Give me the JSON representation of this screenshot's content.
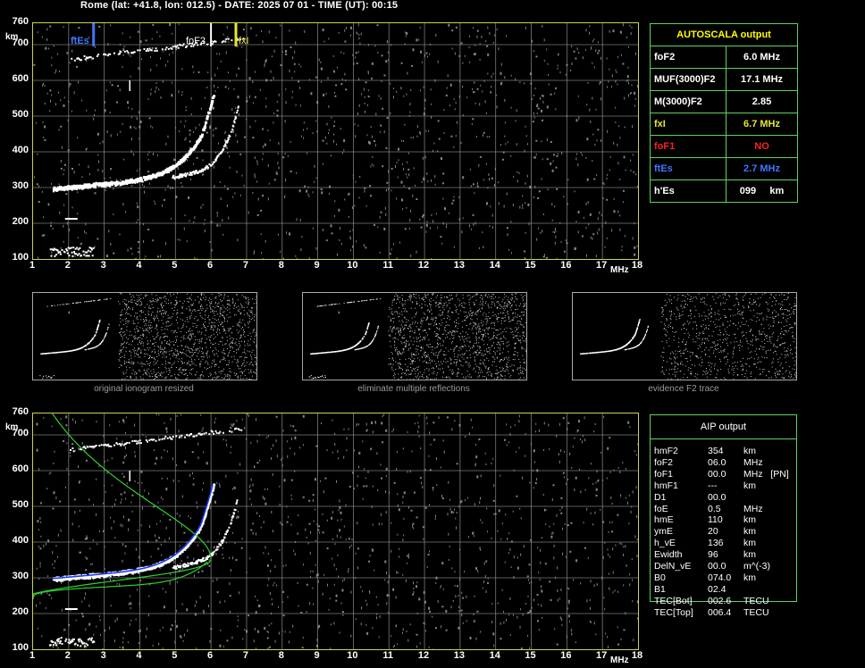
{
  "header": {
    "title": "Rome (lat: +41.8, lon: 012.5) - DATE: 2025 07 01 - TIME (UT): 00:15"
  },
  "axes": {
    "y_ticks": [
      "100",
      "200",
      "300",
      "400",
      "500",
      "600",
      "700",
      "760"
    ],
    "y_unit": "km",
    "x_ticks": [
      "1",
      "2",
      "3",
      "4",
      "5",
      "6",
      "7",
      "8",
      "9",
      "10",
      "11",
      "12",
      "13",
      "14",
      "15",
      "16",
      "17",
      "18"
    ],
    "x_unit": "MHz"
  },
  "markers": {
    "ftEs_label": "ftEs",
    "foF2_label": "foF2",
    "fxI_label": "fxI"
  },
  "thumbnails": {
    "captions": [
      "original ionogram resized",
      "eliminate multiple reflections",
      "evidence F2 trace"
    ]
  },
  "autoscala": {
    "title": "AUTOSCALA output",
    "rows": [
      {
        "param": "foF2",
        "value": "6.0 MHz",
        "color": "#ffffff"
      },
      {
        "param": "MUF(3000)F2",
        "value": "17.1 MHz",
        "color": "#ffffff"
      },
      {
        "param": "M(3000)F2",
        "value": "2.85",
        "color": "#ffffff"
      },
      {
        "param": "fxI",
        "value": "6.7 MHz",
        "color": "#e6e632"
      },
      {
        "param": "foF1",
        "value": "NO",
        "color": "#ff2020"
      },
      {
        "param": "ftEs",
        "value": "2.7 MHz",
        "color": "#3c78ff"
      },
      {
        "param": "h'Es",
        "value": "099     km",
        "color": "#ffffff"
      }
    ],
    "title_color": "#ffff00"
  },
  "aip": {
    "title": "AIP output",
    "rows": [
      {
        "param": "hmF2",
        "value": "354",
        "unit": "km"
      },
      {
        "param": "foF2",
        "value": "06.0",
        "unit": "MHz"
      },
      {
        "param": "foF1",
        "value": "00.0",
        "unit": "MHz   [PN]"
      },
      {
        "param": "hmF1",
        "value": "---",
        "unit": "km"
      },
      {
        "param": "D1",
        "value": "00.0",
        "unit": ""
      },
      {
        "param": "foE",
        "value": "0.5",
        "unit": "MHz"
      },
      {
        "param": "hmE",
        "value": "110",
        "unit": "km"
      },
      {
        "param": "ymE",
        "value": "20",
        "unit": "km"
      },
      {
        "param": "h_vE",
        "value": "136",
        "unit": "km"
      },
      {
        "param": "Ewidth",
        "value": "96",
        "unit": "km"
      },
      {
        "param": "DelN_vE",
        "value": "00.0",
        "unit": "m^(-3)"
      },
      {
        "param": "B0",
        "value": "074.0",
        "unit": "km"
      },
      {
        "param": "B1",
        "value": "02.4",
        "unit": ""
      },
      {
        "param": "TEC[Bot]",
        "value": "002.6",
        "unit": "TECU"
      },
      {
        "param": "TEC[Top]",
        "value": "006.4",
        "unit": "TECU"
      }
    ]
  },
  "colors": {
    "grid": "#9a9a9a",
    "frame": "#cfcf5a",
    "trace": "#ffffff",
    "profile": "#2fd12f",
    "fit": "#1a3cff",
    "ftEs": "#3c78ff",
    "foF2": "#ffffff",
    "fxI": "#e6e632"
  }
}
